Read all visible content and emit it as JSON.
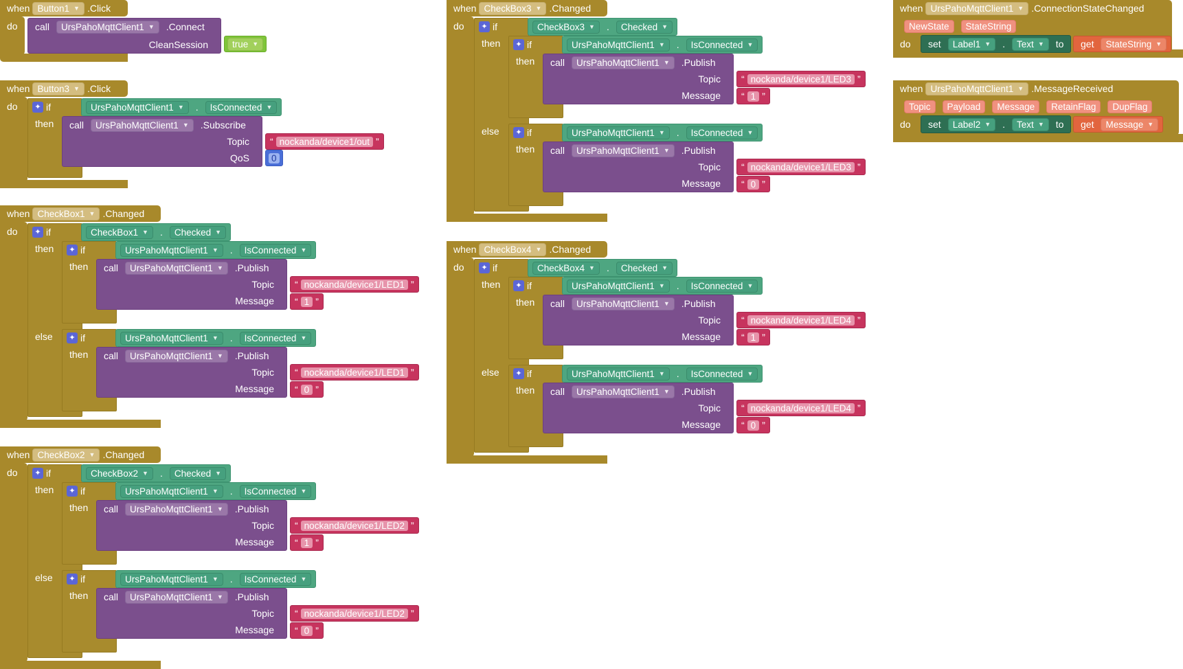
{
  "kw": {
    "when": "when",
    "do": "do",
    "call": "call",
    "if": "if",
    "then": "then",
    "else": "else",
    "set": "set",
    "to": "to",
    "get": "get",
    "dot": ".",
    "q": "“",
    "qe": "”"
  },
  "icons": {
    "dropdown": "dropdown-arrow-icon",
    "gear": "gear-icon"
  },
  "colors": {
    "event": "#a8892b",
    "procedure": "#7b4f8d",
    "component": "#4ea681",
    "text": "#c7345e",
    "math": "#4a6fd8",
    "logic": "#7fc53a",
    "get": "#e2653e",
    "setter": "#2e6f53"
  },
  "b1": {
    "component": "Button1",
    "event": ".Click",
    "client": "UrsPahoMqttClient1",
    "method": ".Connect",
    "param": "CleanSession",
    "value": "true"
  },
  "b3": {
    "component": "Button3",
    "event": ".Click",
    "client": "UrsPahoMqttClient1",
    "prop": "IsConnected",
    "method": ".Subscribe",
    "topic_label": "Topic",
    "topic": "nockanda/device1/out",
    "qos_label": "QoS",
    "qos": "0"
  },
  "cb1": {
    "component": "CheckBox1",
    "event": ".Changed",
    "cond_component": "CheckBox1",
    "cond_prop": "Checked",
    "client": "UrsPahoMqttClient1",
    "prop": "IsConnected",
    "method": ".Publish",
    "topic_label": "Topic",
    "message_label": "Message",
    "topic_on": "nockanda/device1/LED1",
    "msg_on": "1",
    "topic_off": "nockanda/device1/LED1",
    "msg_off": "0"
  },
  "cb2": {
    "component": "CheckBox2",
    "event": ".Changed",
    "cond_component": "CheckBox2",
    "cond_prop": "Checked",
    "client": "UrsPahoMqttClient1",
    "prop": "IsConnected",
    "method": ".Publish",
    "topic_label": "Topic",
    "message_label": "Message",
    "topic_on": "nockanda/device1/LED2",
    "msg_on": "1",
    "topic_off": "nockanda/device1/LED2",
    "msg_off": "0"
  },
  "cb3": {
    "component": "CheckBox3",
    "event": ".Changed",
    "cond_component": "CheckBox3",
    "cond_prop": "Checked",
    "client": "UrsPahoMqttClient1",
    "prop": "IsConnected",
    "method": ".Publish",
    "topic_label": "Topic",
    "message_label": "Message",
    "topic_on": "nockanda/device1/LED3",
    "msg_on": "1",
    "topic_off": "nockanda/device1/LED3",
    "msg_off": "0"
  },
  "cb4": {
    "component": "CheckBox4",
    "event": ".Changed",
    "cond_component": "CheckBox4",
    "cond_prop": "Checked",
    "client": "UrsPahoMqttClient1",
    "prop": "IsConnected",
    "method": ".Publish",
    "topic_label": "Topic",
    "message_label": "Message",
    "topic_on": "nockanda/device1/LED4",
    "msg_on": "1",
    "topic_off": "nockanda/device1/LED4",
    "msg_off": "0"
  },
  "csc": {
    "component": "UrsPahoMqttClient1",
    "event": ".ConnectionStateChanged",
    "params": [
      "NewState",
      "StateString"
    ],
    "set_component": "Label1",
    "set_prop": "Text",
    "get_var": "StateString"
  },
  "mr": {
    "component": "UrsPahoMqttClient1",
    "event": ".MessageReceived",
    "params": [
      "Topic",
      "Payload",
      "Message",
      "RetainFlag",
      "DupFlag"
    ],
    "set_component": "Label2",
    "set_prop": "Text",
    "get_var": "Message"
  }
}
